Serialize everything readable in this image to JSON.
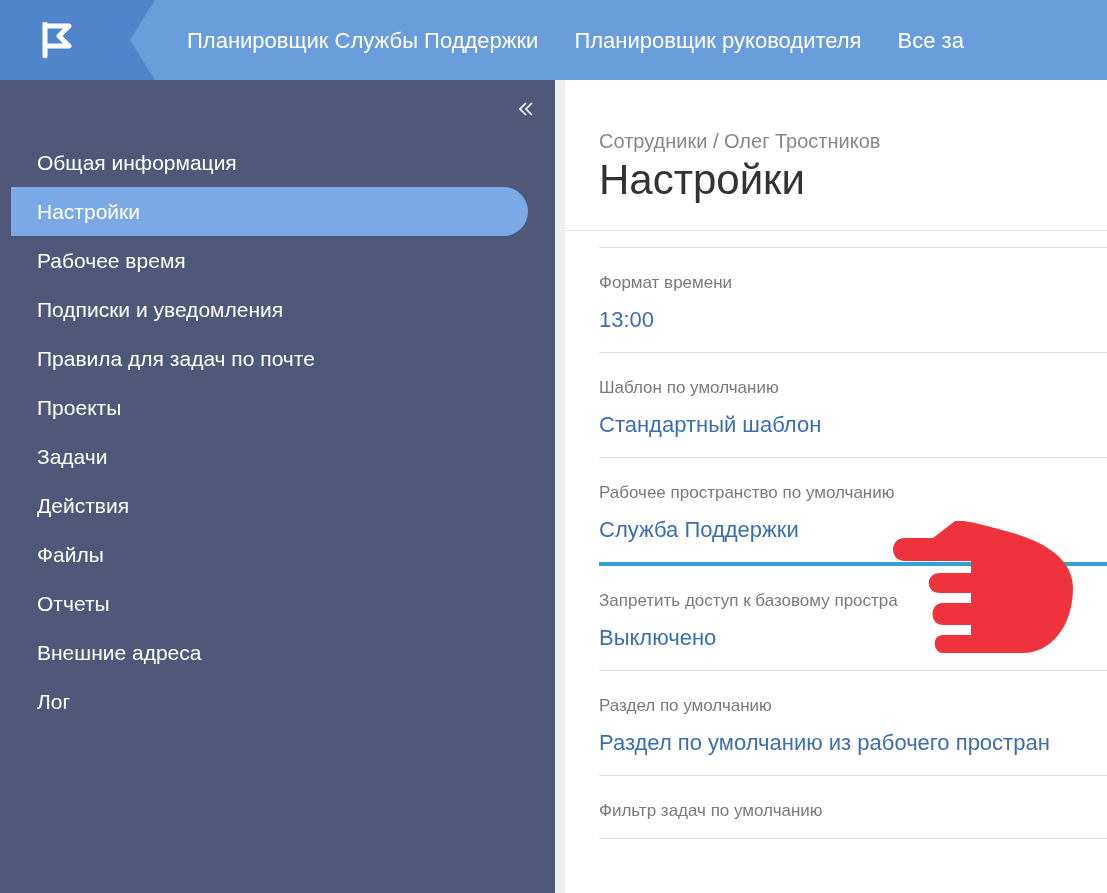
{
  "top_nav": [
    {
      "label": "Планировщик Службы Поддержки"
    },
    {
      "label": "Планировщик руководителя"
    },
    {
      "label": "Все за"
    }
  ],
  "sidebar": {
    "items": [
      {
        "label": "Общая информация",
        "selected": false
      },
      {
        "label": "Настройки",
        "selected": true
      },
      {
        "label": "Рабочее время",
        "selected": false
      },
      {
        "label": "Подписки и уведомления",
        "selected": false
      },
      {
        "label": "Правила для задач по почте",
        "selected": false
      },
      {
        "label": "Проекты",
        "selected": false
      },
      {
        "label": "Задачи",
        "selected": false
      },
      {
        "label": "Действия",
        "selected": false
      },
      {
        "label": "Файлы",
        "selected": false
      },
      {
        "label": "Отчеты",
        "selected": false
      },
      {
        "label": "Внешние адреса",
        "selected": false
      },
      {
        "label": "Лог",
        "selected": false
      }
    ]
  },
  "breadcrumb": "Сотрудники / Олег Тростников",
  "title": "Настройки",
  "settings": [
    {
      "label": "Формат времени",
      "value": "13:00",
      "selected": false
    },
    {
      "label": "Шаблон по умолчанию",
      "value": "Стандартный шаблон",
      "selected": false
    },
    {
      "label": "Рабочее пространство по умолчанию",
      "value": "Служба Поддержки",
      "selected": true
    },
    {
      "label": "Запретить доступ к базовому простра",
      "value": "Выключено",
      "selected": false
    },
    {
      "label": "Раздел по умолчанию",
      "value": "Раздел по умолчанию из рабочего простран",
      "selected": false
    },
    {
      "label": "Фильтр задач по умолчанию",
      "selected": false
    }
  ]
}
